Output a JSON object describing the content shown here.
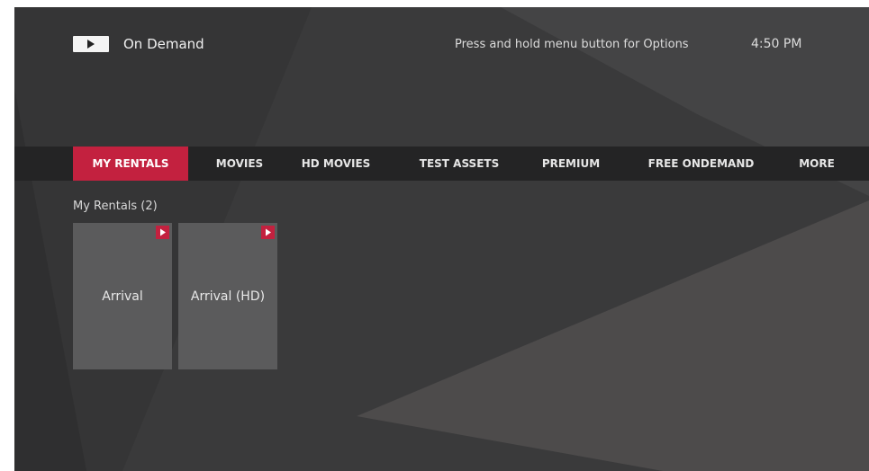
{
  "header": {
    "logo_icon": "play-icon",
    "title": "On Demand",
    "hint": "Press and hold menu button for Options",
    "time": "4:50 PM"
  },
  "nav": {
    "active_index": 0,
    "items": [
      {
        "label": "MY RENTALS"
      },
      {
        "label": "MOVIES"
      },
      {
        "label": "HD MOVIES"
      },
      {
        "label": "TEST ASSETS"
      },
      {
        "label": "PREMIUM"
      },
      {
        "label": "FREE ONDEMAND"
      },
      {
        "label": "MORE"
      }
    ]
  },
  "section": {
    "title": "My Rentals (2)"
  },
  "tiles": [
    {
      "title": "Arrival",
      "badge_icon": "play-icon"
    },
    {
      "title": "Arrival (HD)",
      "badge_icon": "play-icon"
    }
  ],
  "colors": {
    "background": "#3a3a3b",
    "navbar": "#242425",
    "accent": "#c3213f",
    "tile": "#5b5b5c",
    "text": "#f0f0f0"
  }
}
